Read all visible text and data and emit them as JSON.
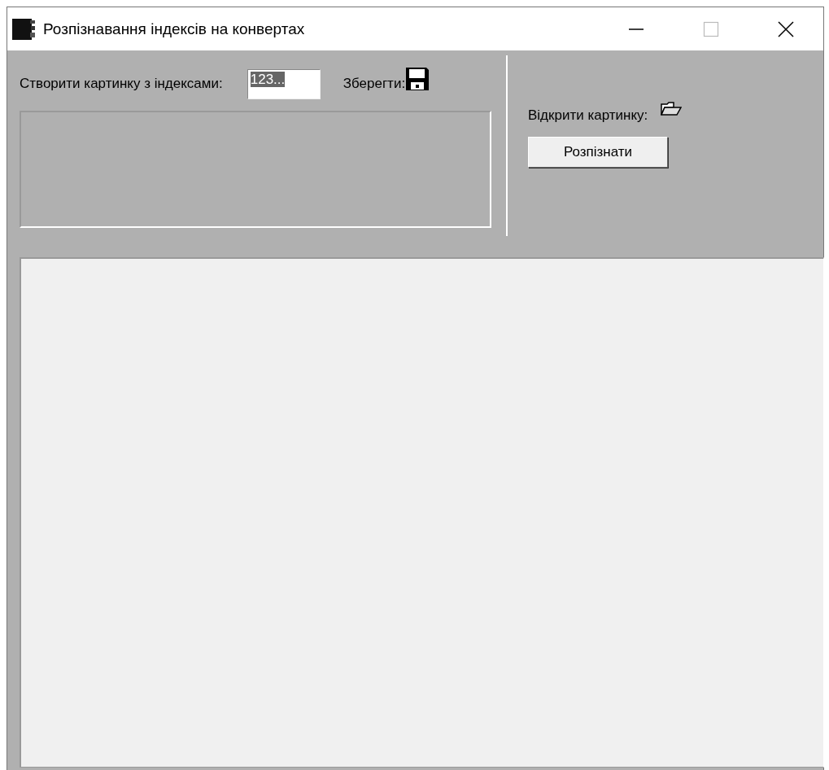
{
  "window": {
    "title": "Розпізнавання індексів на конвертах"
  },
  "create": {
    "label": "Створити картинку з індексами:",
    "index_field": {
      "value": "123...",
      "selected": true
    },
    "save_label": "Зберегти:"
  },
  "open": {
    "label": "Відкрити картинку:",
    "button": "Розпізнати"
  }
}
